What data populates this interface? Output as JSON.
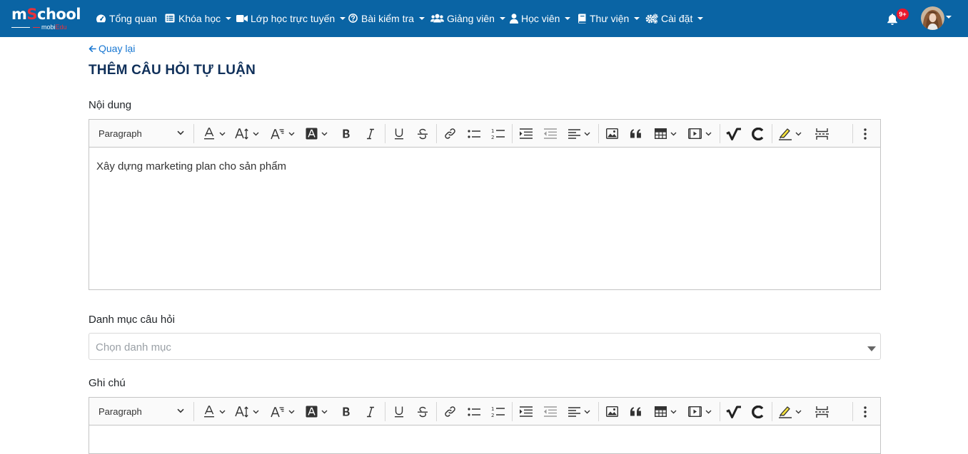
{
  "brand": {
    "logo_main_a": "m",
    "logo_main_b": "S",
    "logo_main_c": "chool",
    "logo_sub_a": "mobi",
    "logo_sub_b": "Edu"
  },
  "colors": {
    "navbar": "#0a64a4",
    "link": "#1877d2",
    "title": "#10305a",
    "badge": "#e8172c"
  },
  "nav": {
    "items": [
      {
        "label": "Tổng quan",
        "icon": "dashboard-icon",
        "dropdown": false
      },
      {
        "label": "Khóa học",
        "icon": "list-icon",
        "dropdown": true
      },
      {
        "label": "Lớp học trực tuyến",
        "icon": "video-icon",
        "dropdown": true
      },
      {
        "label": "Bài kiểm tra",
        "icon": "question-circle-icon",
        "dropdown": true
      },
      {
        "label": "Giảng viên",
        "icon": "users-icon",
        "dropdown": true
      },
      {
        "label": "Học viên",
        "icon": "user-icon",
        "dropdown": true
      },
      {
        "label": "Thư viện",
        "icon": "book-icon",
        "dropdown": true
      },
      {
        "label": "Cài đặt",
        "icon": "cogs-icon",
        "dropdown": true
      }
    ],
    "notification_badge": "9+"
  },
  "page": {
    "back_label": "Quay lại",
    "title": "THÊM CÂU HỎI TỰ LUẬN"
  },
  "form": {
    "content_label": "Nội dung",
    "content_value": "Xây dựng marketing plan cho sản phẩm",
    "category_label": "Danh mục câu hỏi",
    "category_placeholder": "Chọn danh mục",
    "note_label": "Ghi chú"
  },
  "editor_toolbar": {
    "paragraph_label": "Paragraph",
    "tools": [
      "font-color",
      "font-size",
      "font-family",
      "font-background-color",
      "bold",
      "italic",
      "underline",
      "strikethrough",
      "link",
      "bulleted-list",
      "numbered-list",
      "indent",
      "outdent",
      "alignment",
      "image",
      "block-quote",
      "table",
      "media-embed",
      "math-formula",
      "chemistry-formula",
      "highlight",
      "page-break",
      "more"
    ]
  }
}
